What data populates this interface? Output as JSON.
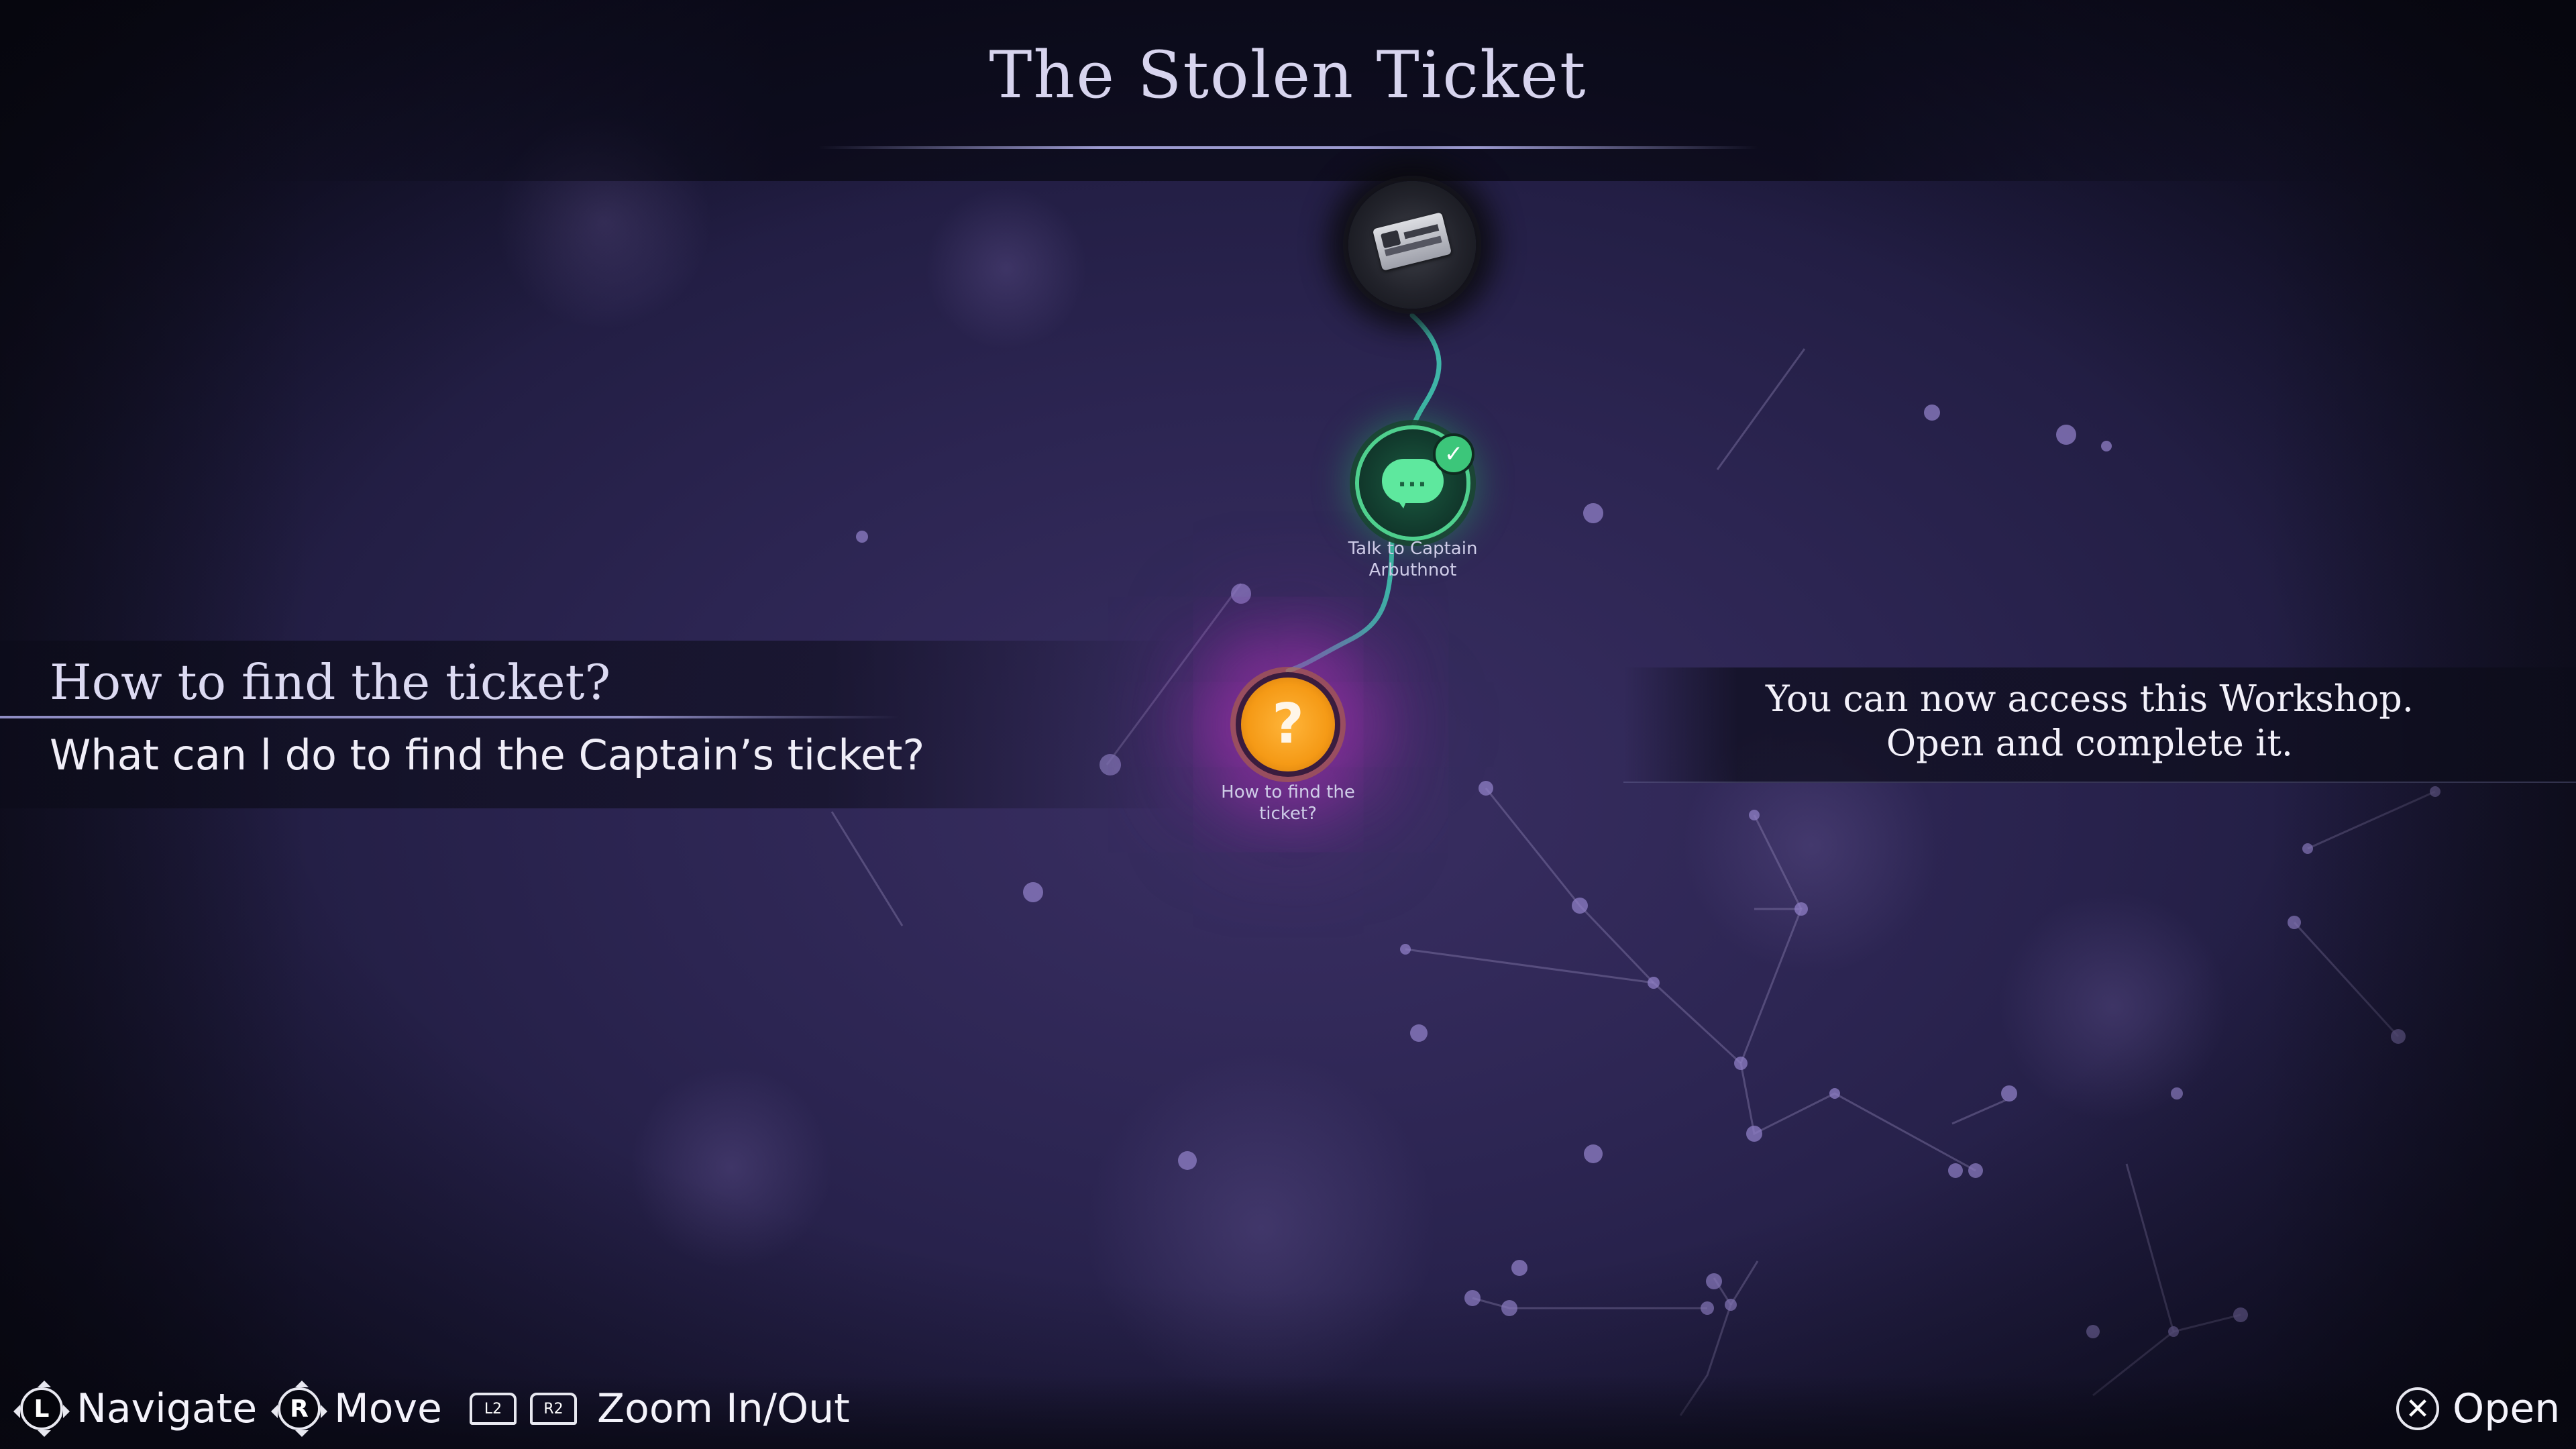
{
  "title": "The Stolen Ticket",
  "quest": {
    "title": "How to find the ticket?",
    "description": "What can l do to find the Captain’s ticket?"
  },
  "info": {
    "text": "You can now access this Workshop. Open and complete it."
  },
  "nodes": {
    "ticket": {
      "icon": "ticket-icon"
    },
    "talk": {
      "icon": "speech-bubble-icon",
      "dots": "...",
      "check": "✓",
      "label": "Talk to Captain Arbuthnot",
      "status": "completed"
    },
    "question": {
      "icon": "question-mark-icon",
      "glyph": "?",
      "label": "How to find the ticket?"
    }
  },
  "footer": {
    "navigate": {
      "button": "L",
      "label": "Navigate"
    },
    "move": {
      "button": "R",
      "label": "Move"
    },
    "zoom": {
      "button_left": "L2",
      "button_right": "R2",
      "label": "Zoom In/Out"
    },
    "open": {
      "button": "✕",
      "label": "Open"
    }
  },
  "colors": {
    "background": "#2c2552",
    "completed_green": "#4fd08e",
    "question_orange": "#f59a16",
    "glow_purple": "#aa32b4",
    "title_text": "#d7d4ee"
  }
}
